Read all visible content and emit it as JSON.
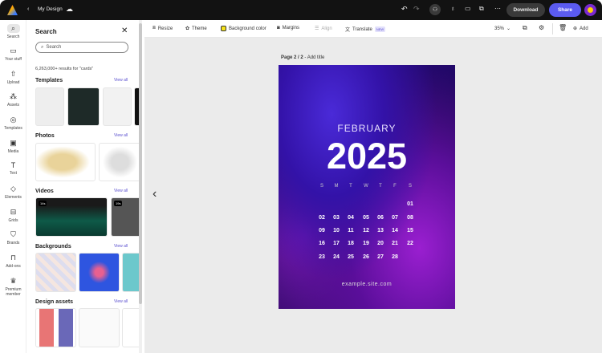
{
  "topbar": {
    "title": "My Design",
    "download": "Download",
    "share": "Share"
  },
  "rail": [
    {
      "label": "Search",
      "icon": "search"
    },
    {
      "label": "Your stuff",
      "icon": "folder"
    },
    {
      "label": "Upload",
      "icon": "upload"
    },
    {
      "label": "Assets",
      "icon": "assets"
    },
    {
      "label": "Templates",
      "icon": "templates"
    },
    {
      "label": "Media",
      "icon": "media"
    },
    {
      "label": "Text",
      "icon": "text"
    },
    {
      "label": "Elements",
      "icon": "elements"
    },
    {
      "label": "Grids",
      "icon": "grids"
    },
    {
      "label": "Brands",
      "icon": "brands"
    },
    {
      "label": "Add-ons",
      "icon": "addons"
    },
    {
      "label": "Premium member",
      "icon": "crown"
    }
  ],
  "panel": {
    "title": "Search",
    "search_placeholder": "Search",
    "results": "6,263,000+ results for \"cards\"",
    "view_all": "View all",
    "sections": [
      "Templates",
      "Photos",
      "Videos",
      "Backgrounds",
      "Design assets"
    ],
    "video_durations": [
      "14s",
      "19s"
    ]
  },
  "toolbar": {
    "resize": "Resize",
    "theme": "Theme",
    "background_color": "Background color",
    "margins": "Margins",
    "align": "Align",
    "translate": "Translate",
    "new_badge": "NEW",
    "zoom": "35%",
    "add": "Add"
  },
  "canvas": {
    "page_label": "Page 2 / 2",
    "add_title": "- Add title"
  },
  "design": {
    "month": "FEBRUARY",
    "year": "2025",
    "weekdays": [
      "S",
      "M",
      "T",
      "W",
      "T",
      "F",
      "S"
    ],
    "weeks": [
      [
        "",
        "",
        "",
        "",
        "",
        "",
        "01"
      ],
      [
        "02",
        "03",
        "04",
        "05",
        "06",
        "07",
        "08"
      ],
      [
        "09",
        "10",
        "11",
        "12",
        "13",
        "14",
        "15"
      ],
      [
        "16",
        "17",
        "18",
        "19",
        "20",
        "21",
        "22"
      ],
      [
        "23",
        "24",
        "25",
        "26",
        "27",
        "28",
        ""
      ]
    ],
    "website": "example.site.com"
  },
  "colors": {
    "accent": "#5b5bf0",
    "topbar": "#121212"
  }
}
